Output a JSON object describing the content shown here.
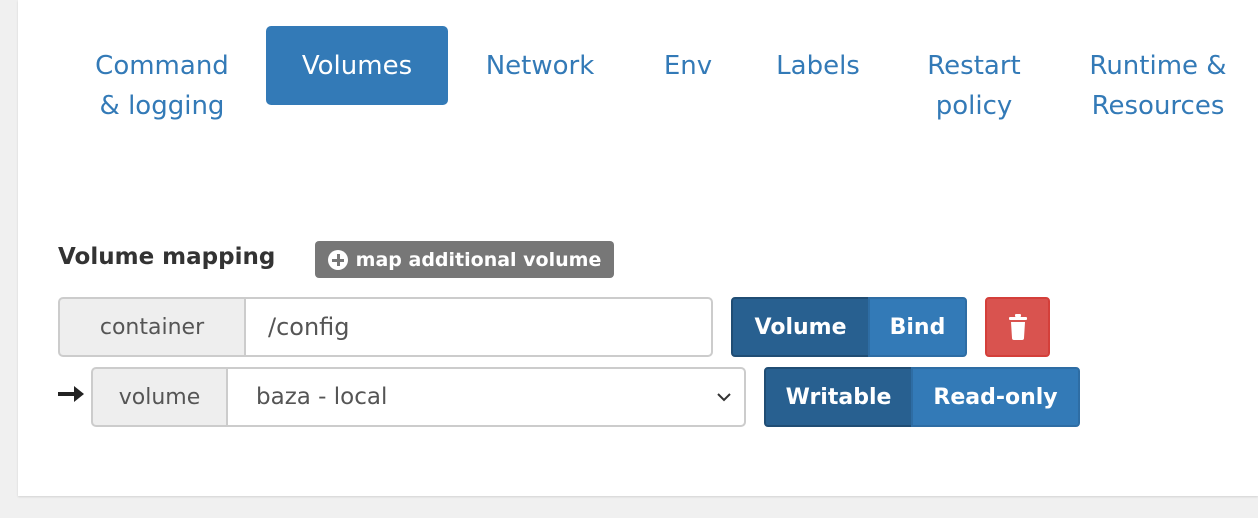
{
  "tabs": [
    {
      "label": "Command & logging",
      "active": false
    },
    {
      "label": "Volumes",
      "active": true
    },
    {
      "label": "Network",
      "active": false
    },
    {
      "label": "Env",
      "active": false
    },
    {
      "label": "Labels",
      "active": false
    },
    {
      "label": "Restart policy",
      "active": false
    },
    {
      "label": "Runtime & Resources",
      "active": false
    }
  ],
  "volume_mapping": {
    "title": "Volume mapping",
    "add_button_label": "map additional volume",
    "add_button_icon": "plus-circle-icon",
    "rows": [
      {
        "addon_label": "container",
        "value": "/config",
        "type_options": [
          "Volume",
          "Bind"
        ],
        "type_selected": "Volume",
        "delete_icon": "trash-icon"
      },
      {
        "arrow_icon": "arrow-right-icon",
        "addon_label": "volume",
        "selected_value": "baza - local",
        "mode_options": [
          "Writable",
          "Read-only"
        ],
        "mode_selected": "Writable"
      }
    ]
  },
  "colors": {
    "primary": "#337ab7",
    "primary_dark": "#286090",
    "danger": "#d9534f",
    "badge_gray": "#777777"
  }
}
